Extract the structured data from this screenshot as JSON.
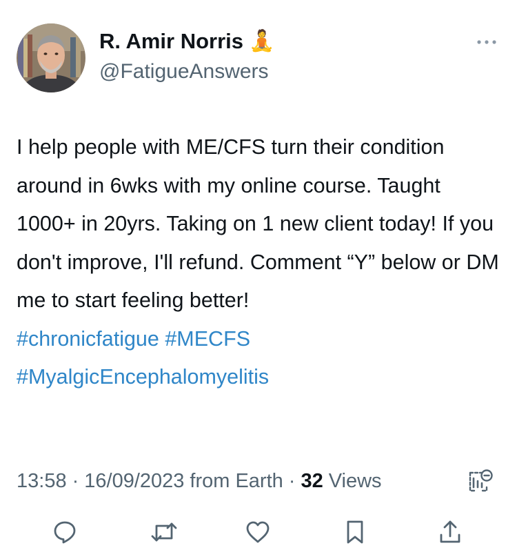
{
  "author": {
    "display_name": "R. Amir Norris",
    "name_emoji": "🧘",
    "handle": "@FatigueAnswers"
  },
  "tweet": {
    "text": "I help people with ME/CFS turn their condition around in 6wks with my online course. Taught 1000+ in 20yrs. Taking on 1 new client today! If you don't improve, I'll refund. Comment “Y” below or DM me to start feeling better!",
    "hashtags": [
      "#chronicfatigue",
      "#MECFS",
      "#MyalgicEncephalomyelitis"
    ]
  },
  "meta": {
    "time": "13:58",
    "dot1": "·",
    "date": "16/09/2023",
    "source": "from Earth",
    "dot2": "·",
    "views_count": "32",
    "views_label": "Views"
  },
  "icons": {
    "more": "more-horizontal-icon",
    "analytics": "analytics-icon",
    "reply": "reply-icon",
    "retweet": "retweet-icon",
    "like": "heart-icon",
    "bookmark": "bookmark-icon",
    "share": "share-icon"
  },
  "colors": {
    "hashtag": "#2f86c8",
    "secondary_text": "#536471",
    "primary_text": "#0f1419"
  }
}
